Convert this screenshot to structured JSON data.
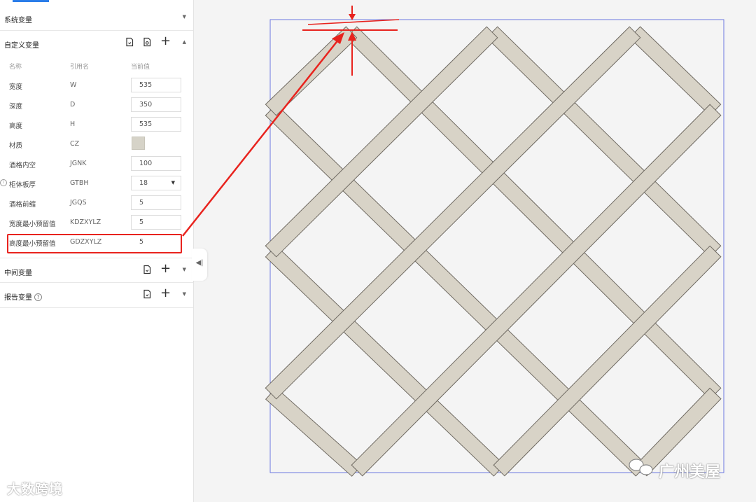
{
  "panel": {
    "sections": {
      "system": {
        "title": "系统变量"
      },
      "custom": {
        "title": "自定义变量"
      },
      "middle": {
        "title": "中间变量"
      },
      "report": {
        "title": "报告变量",
        "help": "?"
      }
    },
    "columns": {
      "name": "名称",
      "ref": "引用名",
      "value": "当前值"
    },
    "variables": [
      {
        "name": "宽度",
        "ref": "W",
        "value": "535"
      },
      {
        "name": "深度",
        "ref": "D",
        "value": "350"
      },
      {
        "name": "高度",
        "ref": "H",
        "value": "535"
      },
      {
        "name": "材质",
        "ref": "CZ",
        "value_color": "#d6d3c8"
      },
      {
        "name": "酒格内空",
        "ref": "JGNK",
        "value": "100"
      },
      {
        "name": "柜体板厚",
        "ref": "GTBH",
        "value": "18"
      },
      {
        "name": "酒格前缩",
        "ref": "JGQS",
        "value": "5"
      },
      {
        "name": "宽度最小预留值",
        "ref": "KDZXYLZ",
        "value": "5"
      },
      {
        "name": "高度最小预留值",
        "ref": "GDZXYLZ",
        "value": "5"
      }
    ]
  },
  "watermarks": {
    "left": "大数跨境",
    "right": "广州美屋"
  },
  "colors": {
    "accent": "#2b7de9",
    "annotation_red": "#e8231e",
    "bounding_box": "#6b78e0",
    "lattice_wood": "#d8d3c7",
    "lattice_edge": "#6f6a62"
  }
}
